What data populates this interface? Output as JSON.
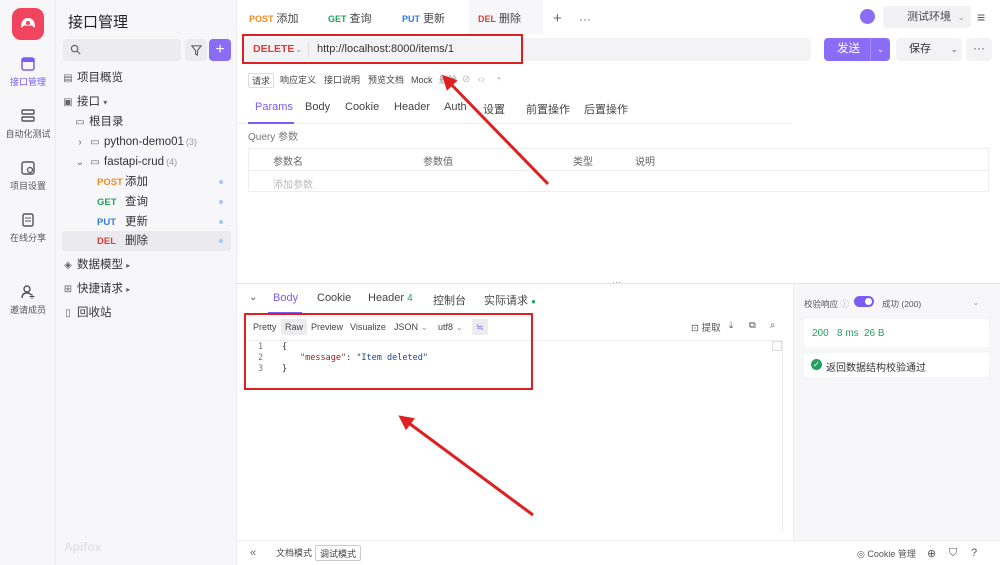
{
  "app": {
    "title": "接口管理",
    "watermark": "Apifox"
  },
  "rail": [
    {
      "label": "接口管理",
      "icon": "api-icon",
      "active": true
    },
    {
      "label": "自动化测试",
      "icon": "automation-icon"
    },
    {
      "label": "项目设置",
      "icon": "settings-icon"
    },
    {
      "label": "在线分享",
      "icon": "share-icon"
    },
    {
      "label": "邀请成员",
      "icon": "invite-icon"
    }
  ],
  "sidebar": {
    "overview": "项目概览",
    "api_root": "接口",
    "root_dir": "根目录",
    "folder1": {
      "name": "python-demo01",
      "count": "(3)"
    },
    "folder2": {
      "name": "fastapi-crud",
      "count": "(4)"
    },
    "items": [
      {
        "method": "POST",
        "name": "添加"
      },
      {
        "method": "GET",
        "name": "查询"
      },
      {
        "method": "PUT",
        "name": "更新"
      },
      {
        "method": "DEL",
        "name": "删除"
      }
    ],
    "models": "数据模型",
    "quick": "快捷请求",
    "trash": "回收站"
  },
  "tabs": [
    {
      "method": "POST",
      "name": "添加"
    },
    {
      "method": "GET",
      "name": "查询"
    },
    {
      "method": "PUT",
      "name": "更新"
    },
    {
      "method": "DEL",
      "name": "删除"
    }
  ],
  "env": "测试环境",
  "request": {
    "method": "DELETE",
    "url": "http://localhost:8000/items/1",
    "send": "发送",
    "save": "保存"
  },
  "subtabs": [
    "请求",
    "响应定义",
    "接口说明",
    "预览文档",
    "Mock",
    "删除"
  ],
  "param_tabs": [
    "Params",
    "Body",
    "Cookie",
    "Header",
    "Auth",
    "设置",
    "前置操作",
    "后置操作"
  ],
  "query": {
    "title": "Query 参数",
    "headers": [
      "参数名",
      "参数值",
      "类型",
      "说明"
    ],
    "add": "添加参数"
  },
  "response": {
    "tabs": [
      "Body",
      "Cookie",
      "Header",
      "控制台",
      "实际请求"
    ],
    "header_count": "4",
    "tools": [
      "Pretty",
      "Raw",
      "Preview",
      "Visualize",
      "JSON",
      "utf8"
    ],
    "extract": "提取",
    "lines": [
      "1",
      "2",
      "3"
    ],
    "code": {
      "open": "{",
      "key": "\"message\"",
      "colon": ": ",
      "value": "\"Item deleted\"",
      "close": "}"
    }
  },
  "right": {
    "validate": "校验响应",
    "status": "成功 (200)",
    "code": "200",
    "time": "8 ms",
    "size": "26 B",
    "ok": "返回数据结构校验通过"
  },
  "footer": {
    "doc_mode": "文档模式",
    "debug_mode": "调试模式",
    "cookie": "Cookie 管理"
  },
  "colors": {
    "accent": "#8a6cf6",
    "annotation": "#e02020"
  }
}
